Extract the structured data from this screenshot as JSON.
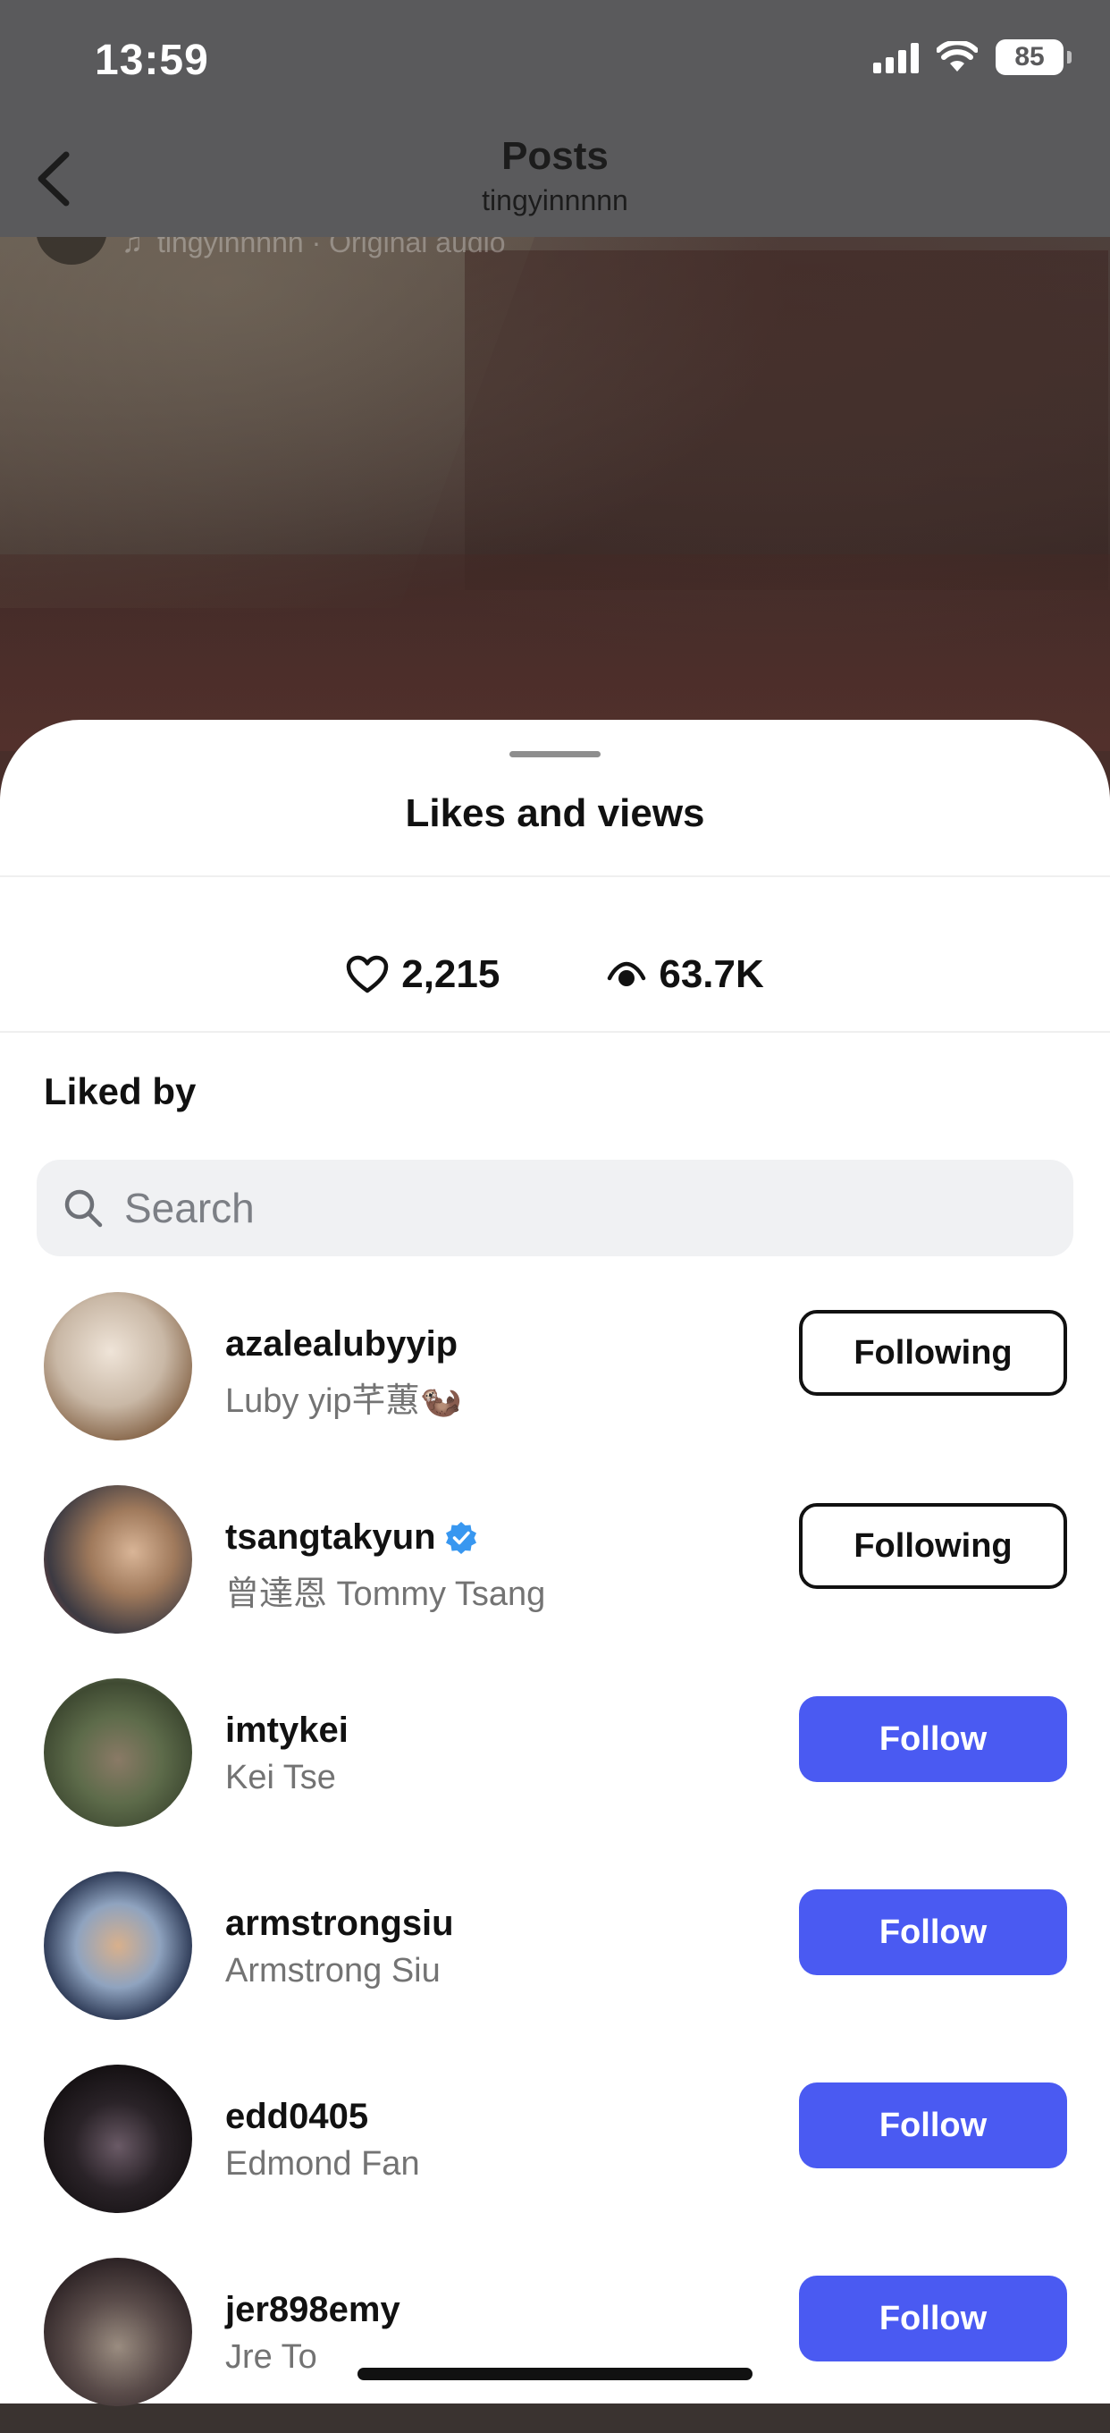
{
  "status": {
    "time": "13:59",
    "battery": "85"
  },
  "header": {
    "title": "Posts",
    "subtitle": "tingyinnnnn"
  },
  "background": {
    "audio_text": "tingyinnnnn · Original audio"
  },
  "sheet": {
    "title": "Likes and views",
    "likes_count": "2,215",
    "views_count": "63.7K",
    "liked_by_label": "Liked by",
    "search_placeholder": "Search"
  },
  "users": [
    {
      "username": "azalealubyyip",
      "fullname": "Luby yip芊蕙🦦",
      "verified": false,
      "action": "Following"
    },
    {
      "username": "tsangtakyun",
      "fullname": "曾達恩 Tommy Tsang",
      "verified": true,
      "action": "Following"
    },
    {
      "username": "imtykei",
      "fullname": "Kei Tse",
      "verified": false,
      "action": "Follow"
    },
    {
      "username": "armstrongsiu",
      "fullname": "Armstrong Siu",
      "verified": false,
      "action": "Follow"
    },
    {
      "username": "edd0405",
      "fullname": "Edmond Fan",
      "verified": false,
      "action": "Follow"
    },
    {
      "username": "jer898emy",
      "fullname": "Jre To",
      "verified": false,
      "action": "Follow"
    }
  ],
  "colors": {
    "follow_button": "#4a5af2",
    "verified_badge": "#3897f0"
  }
}
